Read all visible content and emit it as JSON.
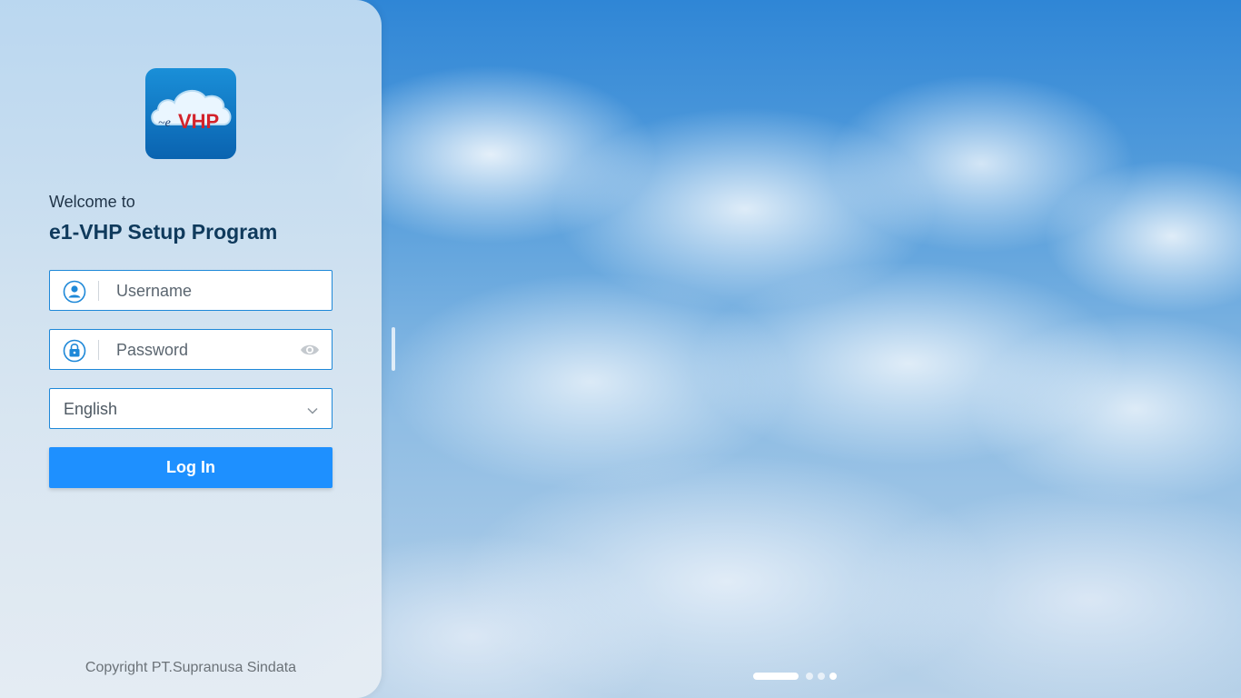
{
  "logo": {
    "text": "e-VHP"
  },
  "login_panel": {
    "welcome": "Welcome to",
    "title": "e1-VHP Setup Program",
    "username": {
      "placeholder": "Username",
      "icon": "user-circle-icon"
    },
    "password": {
      "placeholder": "Password",
      "icon": "lock-icon",
      "toggle_icon": "eye-icon"
    },
    "language": {
      "selected": "English",
      "icon": "chevron-down-icon"
    },
    "login_button": "Log In",
    "copyright": "Copyright PT.Supranusa Sindata"
  },
  "carousel": {
    "slides": 4,
    "active_index": 0
  },
  "colors": {
    "accent": "#1e90ff",
    "field_border": "#1e88d8",
    "title": "#0f3a5c"
  }
}
